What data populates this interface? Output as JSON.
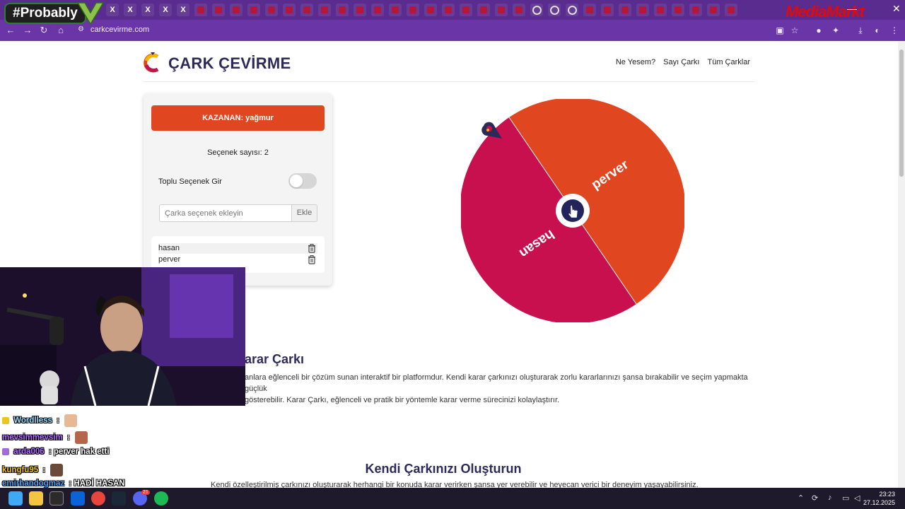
{
  "browser": {
    "url": "carkcevirme.com",
    "tab_badges": [
      "X",
      "X",
      "X",
      "X",
      "X"
    ],
    "overlay_badge": "#Probably",
    "overlay_sponsor": "MediaMarkt"
  },
  "site": {
    "title": "ÇARK ÇEVİRME",
    "nav": [
      "Ne Yesem?",
      "Sayı Çarkı",
      "Tüm Çarklar"
    ]
  },
  "panel": {
    "winner_text": "KAZANAN: yağmur",
    "option_count_text": "Seçenek sayısı: 2",
    "bulk_toggle_label": "Toplu Seçenek Gir",
    "bulk_toggle_on": false,
    "input_placeholder": "Çarka seçenek ekleyin",
    "add_button": "Ekle",
    "options": [
      "hasan",
      "perver"
    ]
  },
  "wheel": {
    "segments": [
      {
        "label": "perver",
        "color": "#e0461f"
      },
      {
        "label": "hasan",
        "color": "#c8104f"
      }
    ],
    "center_color": "#24245c"
  },
  "content": {
    "section1_title": "arar Çarkı",
    "section1_para_line1": "anlara eğlenceli bir çözüm sunan interaktif bir platformdur. Kendi karar çarkınızı oluşturarak zorlu kararlarınızı şansa bırakabilir ve seçim yapmakta güçlük",
    "section1_para_line2": "gösterebilir. Karar Çarkı, eğlenceli ve pratik bir yöntemle karar verme sürecinizi kolaylaştırır.",
    "section2_title": "Kendi Çarkınızı Oluşturun",
    "section2_para": "Kendi özelleştirilmiş çarkınızı oluşturarak herhangi bir konuda karar verirken şansa yer verebilir ve heyecan verici bir deneyim yaşayabilirsiniz."
  },
  "chat": [
    {
      "user": "Wordlless",
      "message": ":",
      "color": "#9adcff"
    },
    {
      "user": "mevsimmevsim",
      "message": ":",
      "color": "#b46bff"
    },
    {
      "user": "arda006",
      "message": ": perver hak etti",
      "color": "#b46bff"
    },
    {
      "user": "kungfu95",
      "message": ":",
      "color": "#f0c419"
    },
    {
      "user": "emirhandogmaz",
      "message": ": HADİ HASAN",
      "color": "#4aa3ff"
    }
  ],
  "taskbar": {
    "time": "23:23",
    "date": "27.12.2025",
    "discord_badge": "21"
  },
  "colors": {
    "accent_orange": "#e0461f",
    "accent_crimson": "#c8104f",
    "title_navy": "#2d2a5a",
    "browser_purple": "#6a35a6"
  }
}
